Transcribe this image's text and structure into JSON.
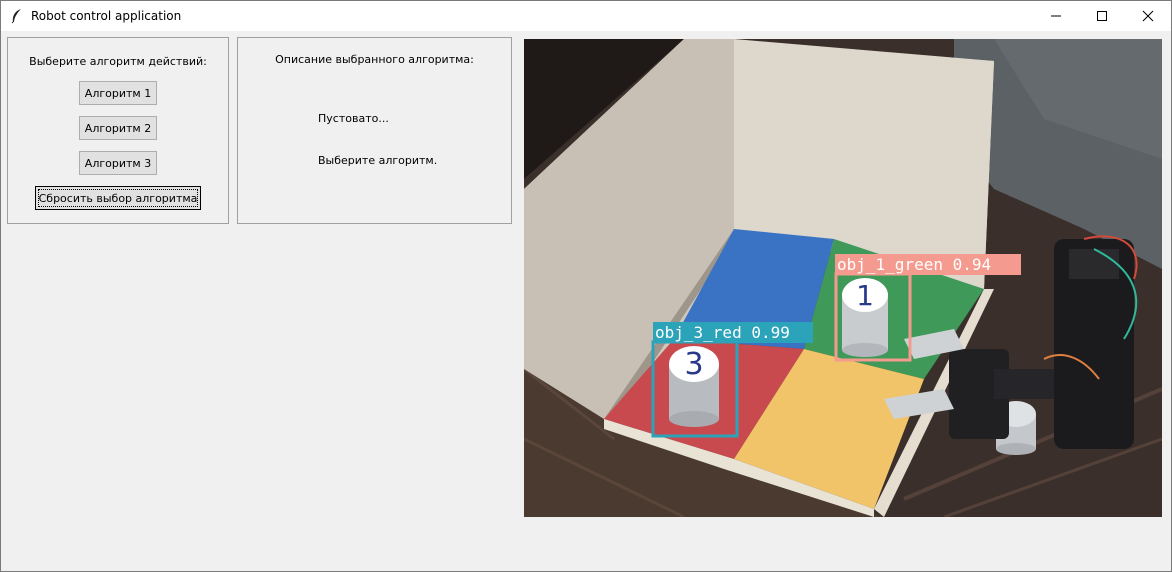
{
  "window": {
    "title": "Robot control application",
    "icons": {
      "app": "feather-icon",
      "minimize": "minimize-icon",
      "maximize": "maximize-icon",
      "close": "close-icon"
    }
  },
  "algorithms_panel": {
    "heading": "Выберите алгоритм действий:",
    "buttons": [
      "Алгоритм 1",
      "Алгоритм 2",
      "Алгоритм 3"
    ],
    "reset_label": "Сбросить выбор алгоритма"
  },
  "description_panel": {
    "heading": "Описание выбранного алгоритма:",
    "lines": [
      "Пустовато...",
      "Выберите алгоритм."
    ]
  },
  "camera": {
    "detections": [
      {
        "label": "obj_1_green 0.94",
        "color": "#f59a8e",
        "digit": "1"
      },
      {
        "label": "obj_3_red 0.99",
        "color": "#2ba3b8",
        "digit": "3"
      }
    ]
  }
}
